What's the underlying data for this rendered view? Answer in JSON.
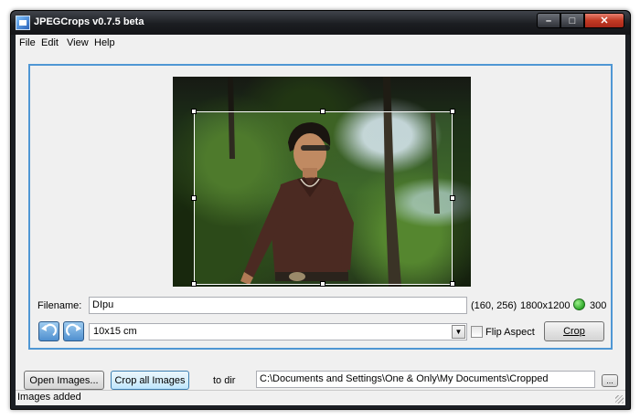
{
  "window": {
    "title": "JPEGCrops v0.7.5 beta",
    "controls": {
      "minimize": "–",
      "maximize": "□",
      "close": "✕"
    }
  },
  "menu": {
    "items": [
      "File",
      "Edit",
      "View",
      "Help"
    ]
  },
  "editor": {
    "filename_label": "Filename:",
    "filename_value": "DIpu",
    "crop_offset": "(160, 256)",
    "crop_size": "1800x1200",
    "dpi": "300",
    "status_color": "#3cb832",
    "format_value": "10x15 cm",
    "flip_aspect_label": "Flip Aspect",
    "flip_aspect_checked": false,
    "crop_button": "Crop",
    "rotate_left_icon": "rotate-left",
    "rotate_right_icon": "rotate-right"
  },
  "toolbar": {
    "open_images": "Open Images...",
    "crop_all_images": "Crop all Images",
    "to_dir_label": "to dir",
    "dir_path": "C:\\Documents and Settings\\One & Only\\My Documents\\Cropped",
    "browse": "..."
  },
  "status": {
    "text": "Images added"
  },
  "colors": {
    "panel_border": "#4f97d4",
    "title_bar": "#1b1d21"
  }
}
